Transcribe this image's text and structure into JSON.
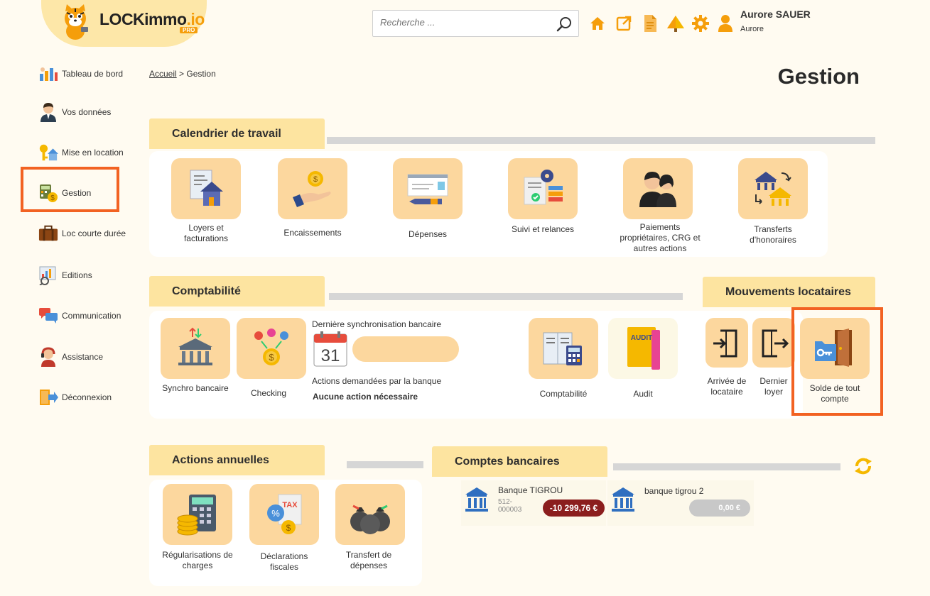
{
  "brand": {
    "name": "LOCKimmo",
    "suffix": ".io",
    "badge": "PRO"
  },
  "header": {
    "search_placeholder": "Recherche ...",
    "icons": [
      "home-icon",
      "external-link-icon",
      "document-icon",
      "tree-icon",
      "gear-icon",
      "user-icon"
    ],
    "user_name": "Aurore SAUER",
    "user_sub": "Aurore"
  },
  "sidebar": {
    "items": [
      {
        "label": "Tableau de bord"
      },
      {
        "label": "Vos données"
      },
      {
        "label": "Mise en location"
      },
      {
        "label": "Gestion"
      },
      {
        "label": "Loc courte durée"
      },
      {
        "label": "Editions"
      },
      {
        "label": "Communication"
      },
      {
        "label": "Assistance"
      },
      {
        "label": "Déconnexion"
      }
    ]
  },
  "breadcrumb": {
    "home": "Accueil",
    "sep": ">",
    "current": "Gestion"
  },
  "page_title": "Gestion",
  "calendrier": {
    "title": "Calendrier de travail",
    "tiles": [
      {
        "label": "Loyers et facturations"
      },
      {
        "label": "Encaissements"
      },
      {
        "label": "Dépenses"
      },
      {
        "label": "Suivi et relances"
      },
      {
        "label": "Paiements propriétaires, CRG et autres actions"
      },
      {
        "label": "Transferts d'honoraires"
      }
    ]
  },
  "comptabilite": {
    "title": "Comptabilité",
    "tiles": [
      {
        "label": "Synchro bancaire"
      },
      {
        "label": "Checking"
      },
      {
        "label": "Comptabilité"
      },
      {
        "label": "Audit"
      }
    ],
    "sync_title": "Dernière synchronisation bancaire",
    "calendar_day": "31",
    "actions_title": "Actions demandées par la banque",
    "actions_value": "Aucune action nécessaire",
    "audit_icon_text": "AUDIT"
  },
  "mouvements": {
    "title": "Mouvements locataires",
    "tiles": [
      {
        "label": "Arrivée de locataire"
      },
      {
        "label": "Dernier loyer"
      },
      {
        "label": "Solde de tout compte"
      }
    ]
  },
  "annuelles": {
    "title": "Actions annuelles",
    "tiles": [
      {
        "label": "Régularisations de charges"
      },
      {
        "label": "Déclarations fiscales"
      },
      {
        "label": "Transfert de dépenses"
      }
    ],
    "tax_icon_text": "TAX"
  },
  "comptes": {
    "title": "Comptes bancaires",
    "accounts": [
      {
        "name": "Banque TIGROU",
        "number": "512-000003",
        "balance": "-10 299,76 €"
      },
      {
        "name": "banque tigrou 2",
        "number": "",
        "balance": "0,00 €"
      }
    ]
  },
  "colors": {
    "accent": "#f59e0b",
    "tile": "#fcd79e",
    "tab": "#fde4a0",
    "highlight": "#f26222",
    "negative": "#8b1e1e"
  }
}
